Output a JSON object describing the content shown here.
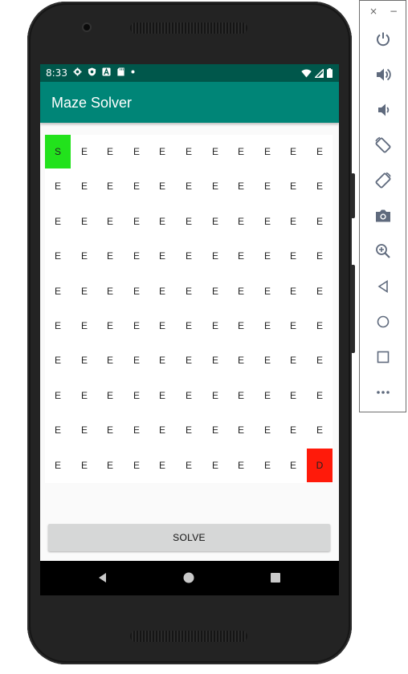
{
  "status_bar": {
    "time": "8:33"
  },
  "app_bar": {
    "title": "Maze Solver"
  },
  "maze": {
    "rows": [
      [
        "S",
        "E",
        "E",
        "E",
        "E",
        "E",
        "E",
        "E",
        "E",
        "E",
        "E"
      ],
      [
        "E",
        "E",
        "E",
        "E",
        "E",
        "E",
        "E",
        "E",
        "E",
        "E",
        "E"
      ],
      [
        "E",
        "E",
        "E",
        "E",
        "E",
        "E",
        "E",
        "E",
        "E",
        "E",
        "E"
      ],
      [
        "E",
        "E",
        "E",
        "E",
        "E",
        "E",
        "E",
        "E",
        "E",
        "E",
        "E"
      ],
      [
        "E",
        "E",
        "E",
        "E",
        "E",
        "E",
        "E",
        "E",
        "E",
        "E",
        "E"
      ],
      [
        "E",
        "E",
        "E",
        "E",
        "E",
        "E",
        "E",
        "E",
        "E",
        "E",
        "E"
      ],
      [
        "E",
        "E",
        "E",
        "E",
        "E",
        "E",
        "E",
        "E",
        "E",
        "E",
        "E"
      ],
      [
        "E",
        "E",
        "E",
        "E",
        "E",
        "E",
        "E",
        "E",
        "E",
        "E",
        "E"
      ],
      [
        "E",
        "E",
        "E",
        "E",
        "E",
        "E",
        "E",
        "E",
        "E",
        "E",
        "E"
      ],
      [
        "E",
        "E",
        "E",
        "E",
        "E",
        "E",
        "E",
        "E",
        "E",
        "E",
        "D"
      ]
    ],
    "start_color": "#22e21c",
    "destination_color": "#ff1a0a"
  },
  "solve_button": {
    "label": "SOLVE"
  },
  "colors": {
    "status_bar": "#00574b",
    "app_bar": "#008577"
  },
  "nav_bar": {
    "icons": [
      "back-icon",
      "home-icon",
      "recents-icon"
    ]
  },
  "emulator_toolbar": {
    "close_label": "×",
    "minimize_label": "−",
    "buttons": [
      "power-icon",
      "volume-up-icon",
      "volume-down-icon",
      "rotate-left-icon",
      "rotate-right-icon",
      "camera-icon",
      "zoom-icon",
      "back-icon",
      "home-icon",
      "overview-icon",
      "more-icon"
    ]
  }
}
